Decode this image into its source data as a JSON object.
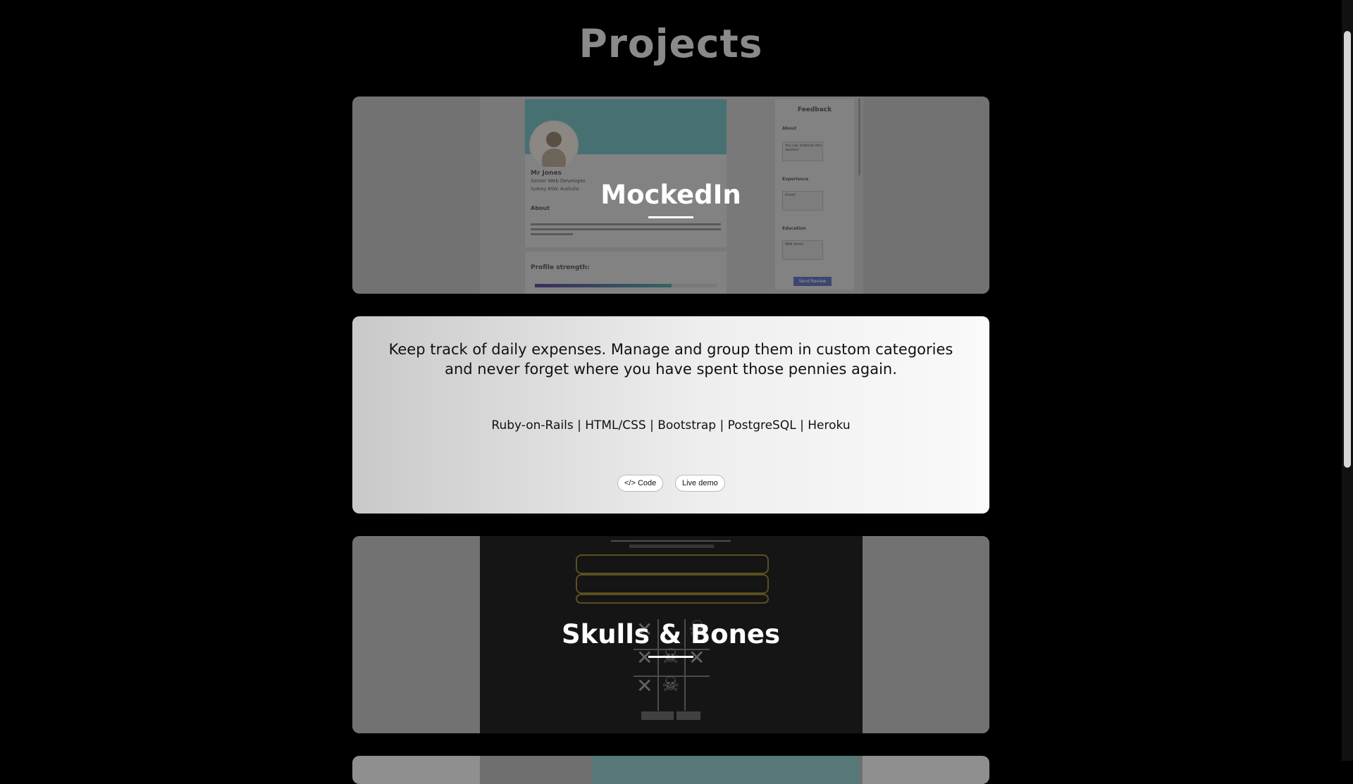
{
  "page": {
    "title": "Projects"
  },
  "projects": [
    {
      "title": "MockedIn",
      "preview": {
        "name": "Mr Jones",
        "role": "Senior Web Developer",
        "location": "Sydney NSW, Australia",
        "about_heading": "About",
        "strength_heading": "Profile strength:",
        "feedback": {
          "title": "Feedback",
          "about_label": "About",
          "about_value": "You can improve this section!",
          "experience_label": "Experience",
          "experience_value": "Great!",
          "education_label": "Education",
          "education_value": "Well done!",
          "send_label": "Send Review"
        }
      }
    },
    {
      "description": "Keep track of daily expenses. Manage and group them in custom categories and never forget where you have spent those pennies again.",
      "tech": "Ruby-on-Rails | HTML/CSS | Bootstrap | PostgreSQL | Heroku",
      "code_label": "</> Code",
      "demo_label": "Live demo"
    },
    {
      "title": "Skulls & Bones"
    }
  ],
  "colors": {
    "background": "#000000",
    "title": "#8a8a8a",
    "card": "#8f8f8f"
  }
}
